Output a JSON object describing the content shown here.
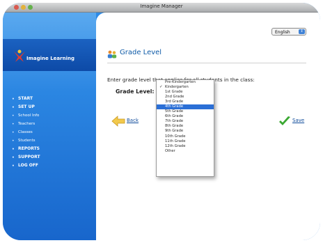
{
  "window": {
    "title": "Imagine Manager"
  },
  "logo": {
    "text": "Imagine Learning"
  },
  "sidebar": {
    "items": [
      {
        "label": "START",
        "sub": false
      },
      {
        "label": "SET UP",
        "sub": false
      },
      {
        "label": "School Info",
        "sub": true
      },
      {
        "label": "Teachers",
        "sub": true
      },
      {
        "label": "Classes",
        "sub": true
      },
      {
        "label": "Students",
        "sub": true
      },
      {
        "label": "REPORTS",
        "sub": false
      },
      {
        "label": "SUPPORT",
        "sub": false
      },
      {
        "label": "LOG OFF",
        "sub": false
      }
    ]
  },
  "language": {
    "selected": "English"
  },
  "page": {
    "title": "Grade Level",
    "instruction": "Enter grade level that applies for all students in the class:",
    "grade_label": "Grade Level:"
  },
  "dropdown": {
    "options": [
      "Pre-Kindergarten",
      "Kindergarten",
      "1st Grade",
      "2nd Grade",
      "3rd Grade",
      "4th Grade",
      "5th Grade",
      "6th Grade",
      "7th Grade",
      "8th Grade",
      "9th Grade",
      "10th Grade",
      "11th Grade",
      "12th Grade",
      "Other"
    ],
    "checked": "Kindergarten",
    "highlighted": "4th Grade"
  },
  "buttons": {
    "back": "Back",
    "save": "Save"
  },
  "colors": {
    "accent": "#0d5aa7",
    "highlight": "#2b6fd6",
    "save_check": "#3aa832",
    "back_arrow": "#f2c94c"
  }
}
